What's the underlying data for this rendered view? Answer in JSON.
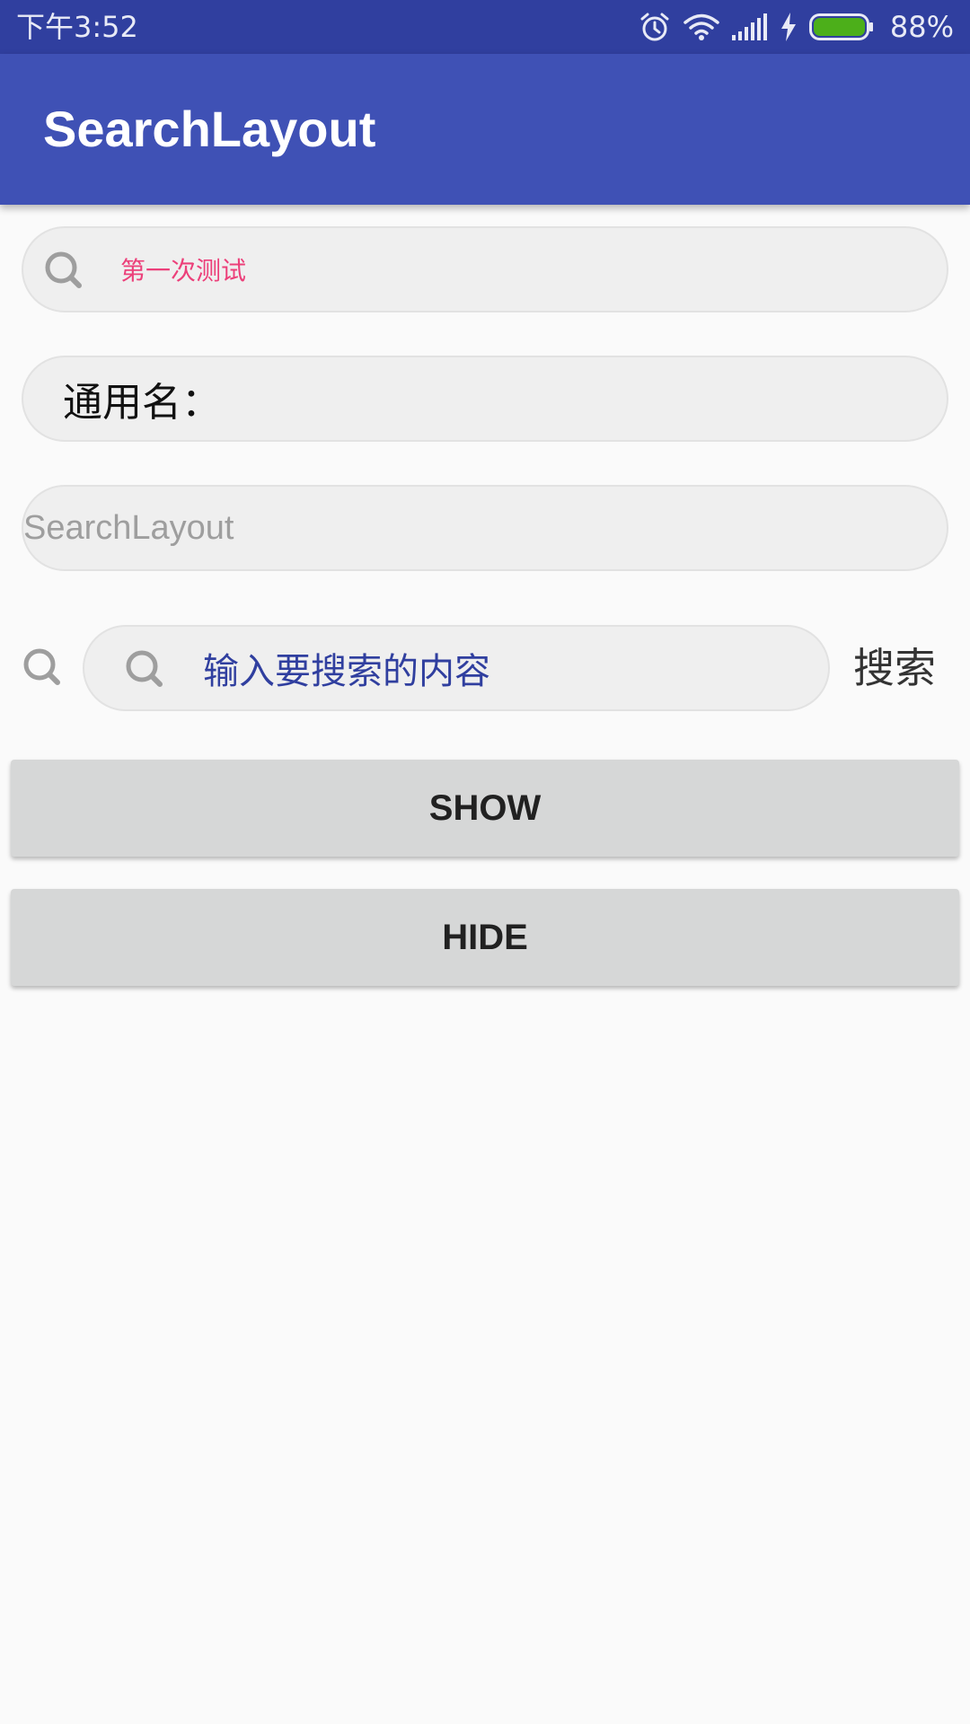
{
  "status_bar": {
    "time": "下午3:52",
    "battery_percent": "88%",
    "battery_level": 0.88,
    "icons": [
      "alarm-icon",
      "wifi-icon",
      "signal-icon",
      "charging-icon",
      "battery-icon"
    ],
    "background_color": "#303f9f"
  },
  "app_bar": {
    "title": "SearchLayout",
    "background_color": "#3f51b5"
  },
  "search_layouts": [
    {
      "text": "第一次测试",
      "text_color": "#ec407a",
      "icon": "search-icon"
    },
    {
      "text": "通用名：",
      "text_color": "#111111"
    },
    {
      "text": "SearchLayout",
      "text_color": "#9e9e9e"
    },
    {
      "placeholder": "输入要搜索的内容",
      "text_color": "#303f9f",
      "icon": "search-icon",
      "outer_icon": "search-icon",
      "action_label": "搜索"
    }
  ],
  "buttons": {
    "show_label": "SHOW",
    "hide_label": "HIDE"
  }
}
